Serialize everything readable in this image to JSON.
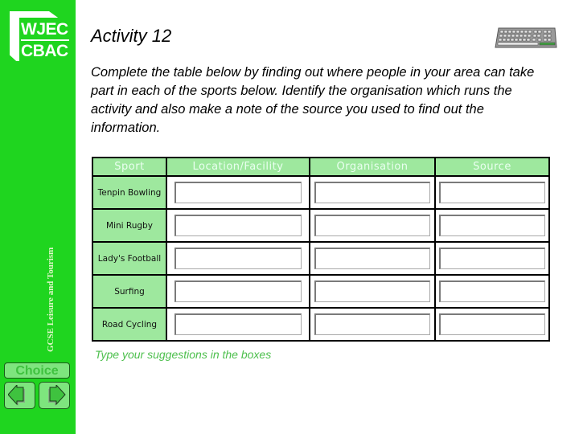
{
  "sidebar": {
    "logo": {
      "line1": "WJEC",
      "line2": "CBAC"
    },
    "vertical_label": "GCSE Leisure and Tourism",
    "choice_label": "Choice",
    "nav": {
      "prev_icon": "left-arrow-icon",
      "next_icon": "right-arrow-icon"
    }
  },
  "header": {
    "title": "Activity 12",
    "icon": "keyboard-icon"
  },
  "instructions": "Complete the table below by finding out where people in your area can take part in each of the sports below.  Identify the organisation which runs the activity and also make a note of the source you used to find out the information.",
  "table": {
    "columns": [
      "Sport",
      "Location/Facility",
      "Organisation",
      "Source"
    ],
    "rows": [
      {
        "sport": "Tenpin Bowling",
        "location": "",
        "organisation": "",
        "source": ""
      },
      {
        "sport": "Mini Rugby",
        "location": "",
        "organisation": "",
        "source": ""
      },
      {
        "sport": "Lady's Football",
        "location": "",
        "organisation": "",
        "source": ""
      },
      {
        "sport": "Surfing",
        "location": "",
        "organisation": "",
        "source": ""
      },
      {
        "sport": "Road Cycling",
        "location": "",
        "organisation": "",
        "source": ""
      }
    ]
  },
  "hint": "Type your suggestions in the boxes",
  "colors": {
    "sidebar": "#1fd51f",
    "header_cell": "#9ee89e",
    "hint": "#4cbf4c"
  }
}
